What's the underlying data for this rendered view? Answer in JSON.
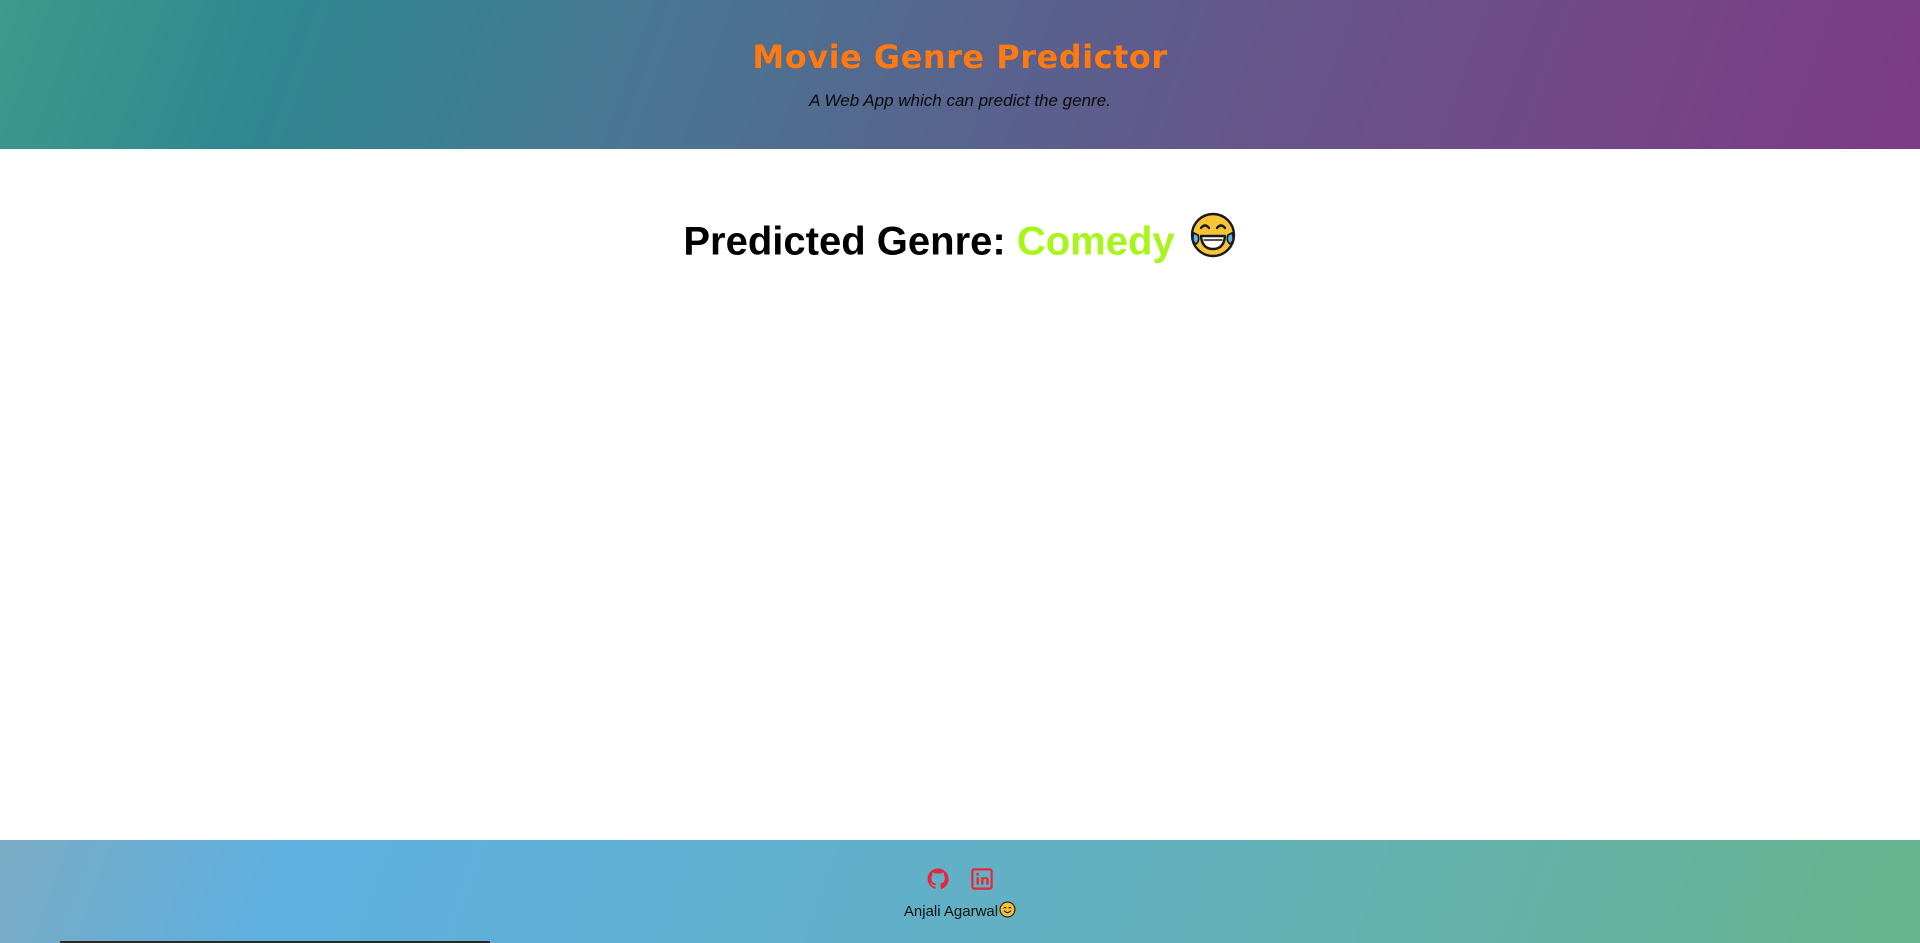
{
  "header": {
    "title": "Movie Genre Predictor",
    "subtitle": "A Web App which can predict the genre."
  },
  "prediction": {
    "label": "Predicted Genre: ",
    "genre": "Comedy",
    "emoji_icon": "laughing-tears-emoji-icon"
  },
  "footer": {
    "links": [
      {
        "icon": "github-icon"
      },
      {
        "icon": "linkedin-icon"
      }
    ],
    "author": "Anjali Agarwal",
    "author_emoji_icon": "smiling-hearts-emoji-icon"
  },
  "colors": {
    "title": "#ff7a12",
    "genre": "#a8f51a",
    "social_icon": "#e8263a"
  }
}
